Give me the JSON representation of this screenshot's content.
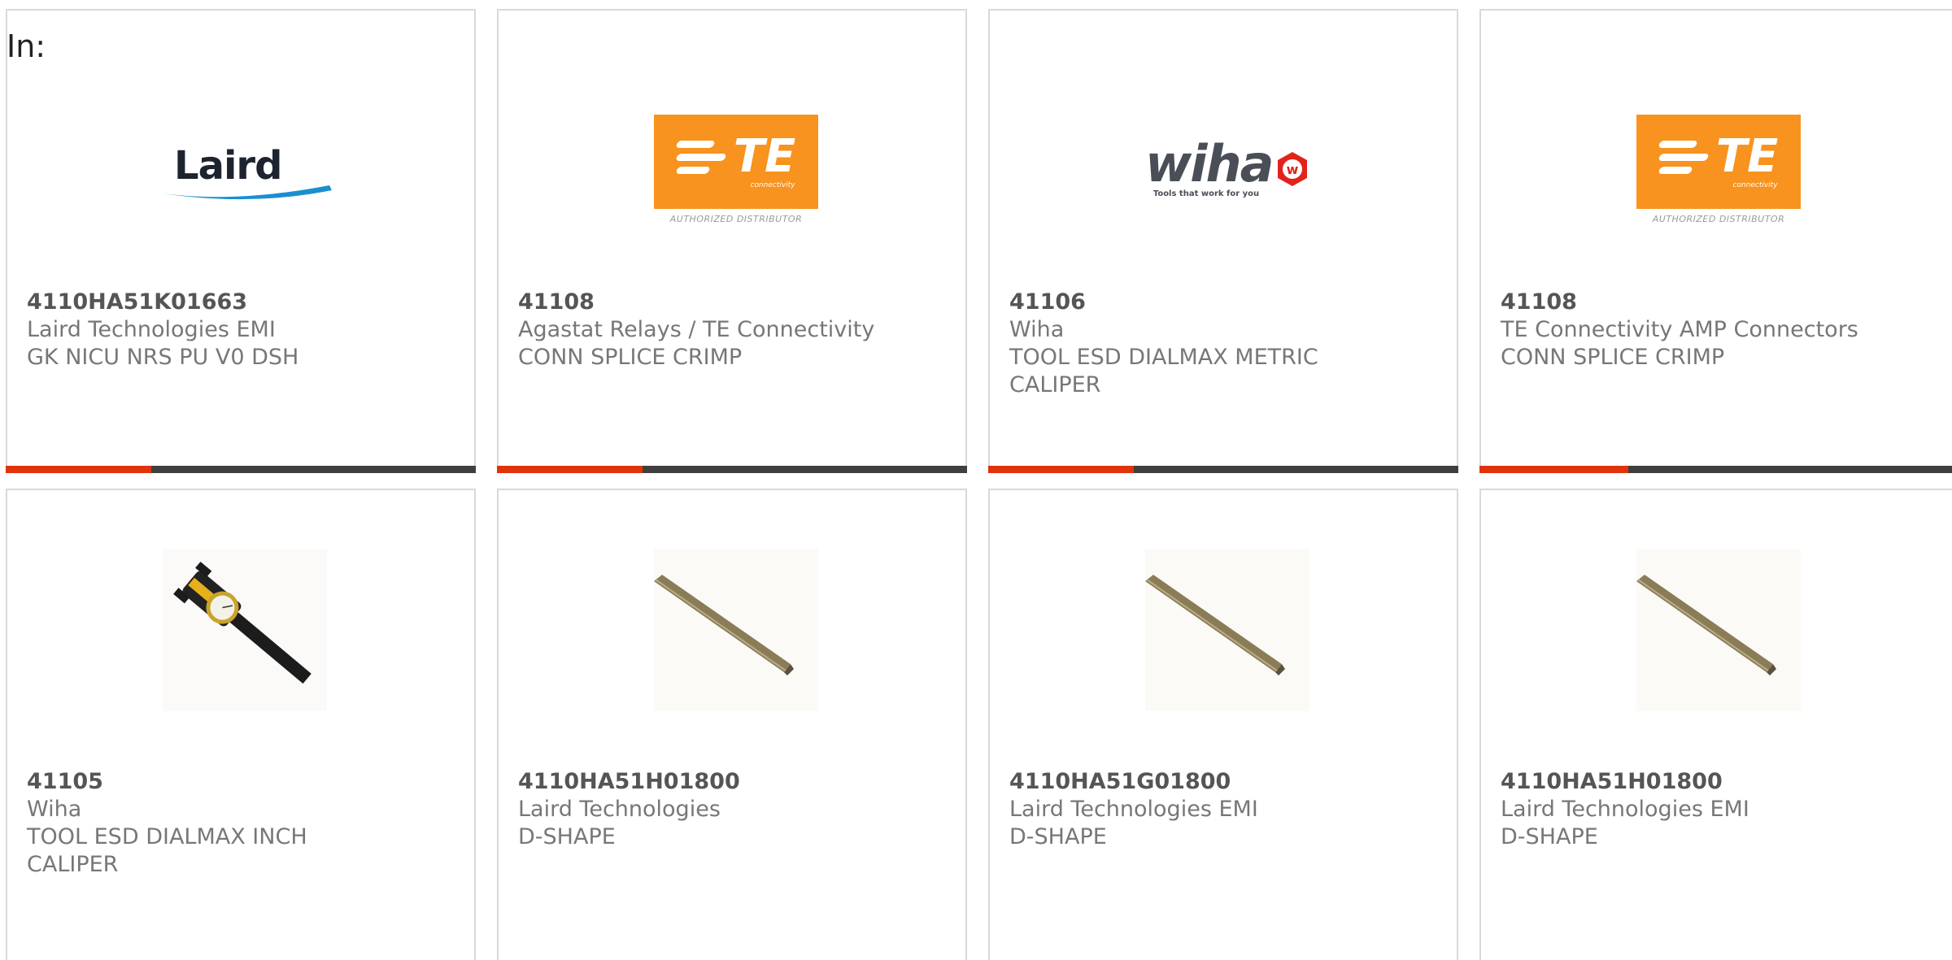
{
  "header": {
    "in_label": "In:"
  },
  "products": [
    {
      "part_number": "4110HA51K01663",
      "manufacturer": "Laird Technologies EMI",
      "description": "GK NICU NRS PU V0 DSH",
      "image": "laird-logo"
    },
    {
      "part_number": "41108",
      "manufacturer": "Agastat Relays / TE Connectivity",
      "description": "CONN SPLICE CRIMP",
      "image": "te-connectivity-logo",
      "logo_text": "TE",
      "logo_sub": "connectivity",
      "logo_caption": "AUTHORIZED DISTRIBUTOR"
    },
    {
      "part_number": "41106",
      "manufacturer": "Wiha",
      "description": "TOOL ESD DIALMAX METRIC CALIPER",
      "image": "wiha-logo",
      "logo_text": "wiha",
      "logo_tagline": "Tools that work for you"
    },
    {
      "part_number": "41108",
      "manufacturer": "TE Connectivity AMP Connectors",
      "description": "CONN SPLICE CRIMP",
      "image": "te-connectivity-logo",
      "logo_text": "TE",
      "logo_sub": "connectivity",
      "logo_caption": "AUTHORIZED DISTRIBUTOR"
    },
    {
      "part_number": "41105",
      "manufacturer": "Wiha",
      "description": "TOOL ESD DIALMAX INCH CALIPER",
      "image": "dial-caliper-photo"
    },
    {
      "part_number": "4110HA51H01800",
      "manufacturer": "Laird Technologies",
      "description": "D-SHAPE",
      "image": "d-shape-gasket-photo"
    },
    {
      "part_number": "4110HA51G01800",
      "manufacturer": "Laird Technologies EMI",
      "description": "D-SHAPE",
      "image": "d-shape-gasket-photo"
    },
    {
      "part_number": "4110HA51H01800",
      "manufacturer": "Laird Technologies EMI",
      "description": "D-SHAPE",
      "image": "d-shape-gasket-photo"
    }
  ],
  "colors": {
    "accent": "#e0330c",
    "bar_track": "#3f3f3f",
    "te_orange": "#f7931e",
    "laird_blue": "#1a8fd0",
    "wiha_red": "#e2231a"
  },
  "card_bar_fill_fraction": 0.31
}
